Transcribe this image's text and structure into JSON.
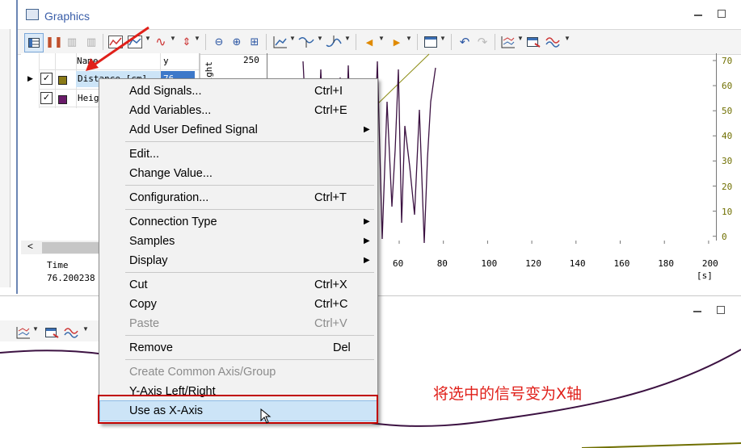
{
  "window": {
    "title": "Graphics"
  },
  "signal_table": {
    "col_name": "Name",
    "col_y": "y",
    "rows": [
      {
        "name": "Distance [cm]",
        "color": "#8a7a16",
        "checked": true,
        "value": "76"
      },
      {
        "name": "Height",
        "color": "#6a1b6a",
        "checked": true
      }
    ],
    "time_label": "Time",
    "time_value": "76.200238"
  },
  "plot": {
    "y_axis_label": "Height",
    "y_left_top": "250",
    "x_ticks": [
      "60",
      "80",
      "100",
      "120",
      "140",
      "160",
      "180",
      "200"
    ],
    "x_unit": "[s]",
    "y_right_ticks": [
      "70",
      "60",
      "50",
      "40",
      "30",
      "20",
      "10",
      "0"
    ],
    "colors": {
      "height": "#3c1242",
      "distance": "#8a8a10"
    }
  },
  "context_menu": {
    "items": [
      {
        "label": "Add Signals...",
        "shortcut": "Ctrl+I"
      },
      {
        "label": "Add Variables...",
        "shortcut": "Ctrl+E"
      },
      {
        "label": "Add User Defined Signal",
        "submenu": true
      },
      {
        "label": "Edit..."
      },
      {
        "label": "Change Value..."
      },
      {
        "label": "Configuration...",
        "shortcut": "Ctrl+T"
      },
      {
        "label": "Connection Type",
        "submenu": true
      },
      {
        "label": "Samples",
        "submenu": true
      },
      {
        "label": "Display",
        "submenu": true
      },
      {
        "label": "Cut",
        "shortcut": "Ctrl+X"
      },
      {
        "label": "Copy",
        "shortcut": "Ctrl+C"
      },
      {
        "label": "Paste",
        "shortcut": "Ctrl+V",
        "disabled": true
      },
      {
        "label": "Remove",
        "shortcut": "Del"
      },
      {
        "label": "Create Common Axis/Group",
        "disabled": true
      },
      {
        "label": "Y-Axis Left/Right"
      },
      {
        "label": "Use as X-Axis",
        "highlighted": true
      }
    ]
  },
  "annotation": {
    "text": "将选中的信号变为X轴",
    "color": "#e0201a"
  },
  "icons": [
    "graphics-window-icon",
    "minimize-icon",
    "maximize-icon",
    "arrow-pointer-icon",
    "mouse-cursor-icon"
  ]
}
